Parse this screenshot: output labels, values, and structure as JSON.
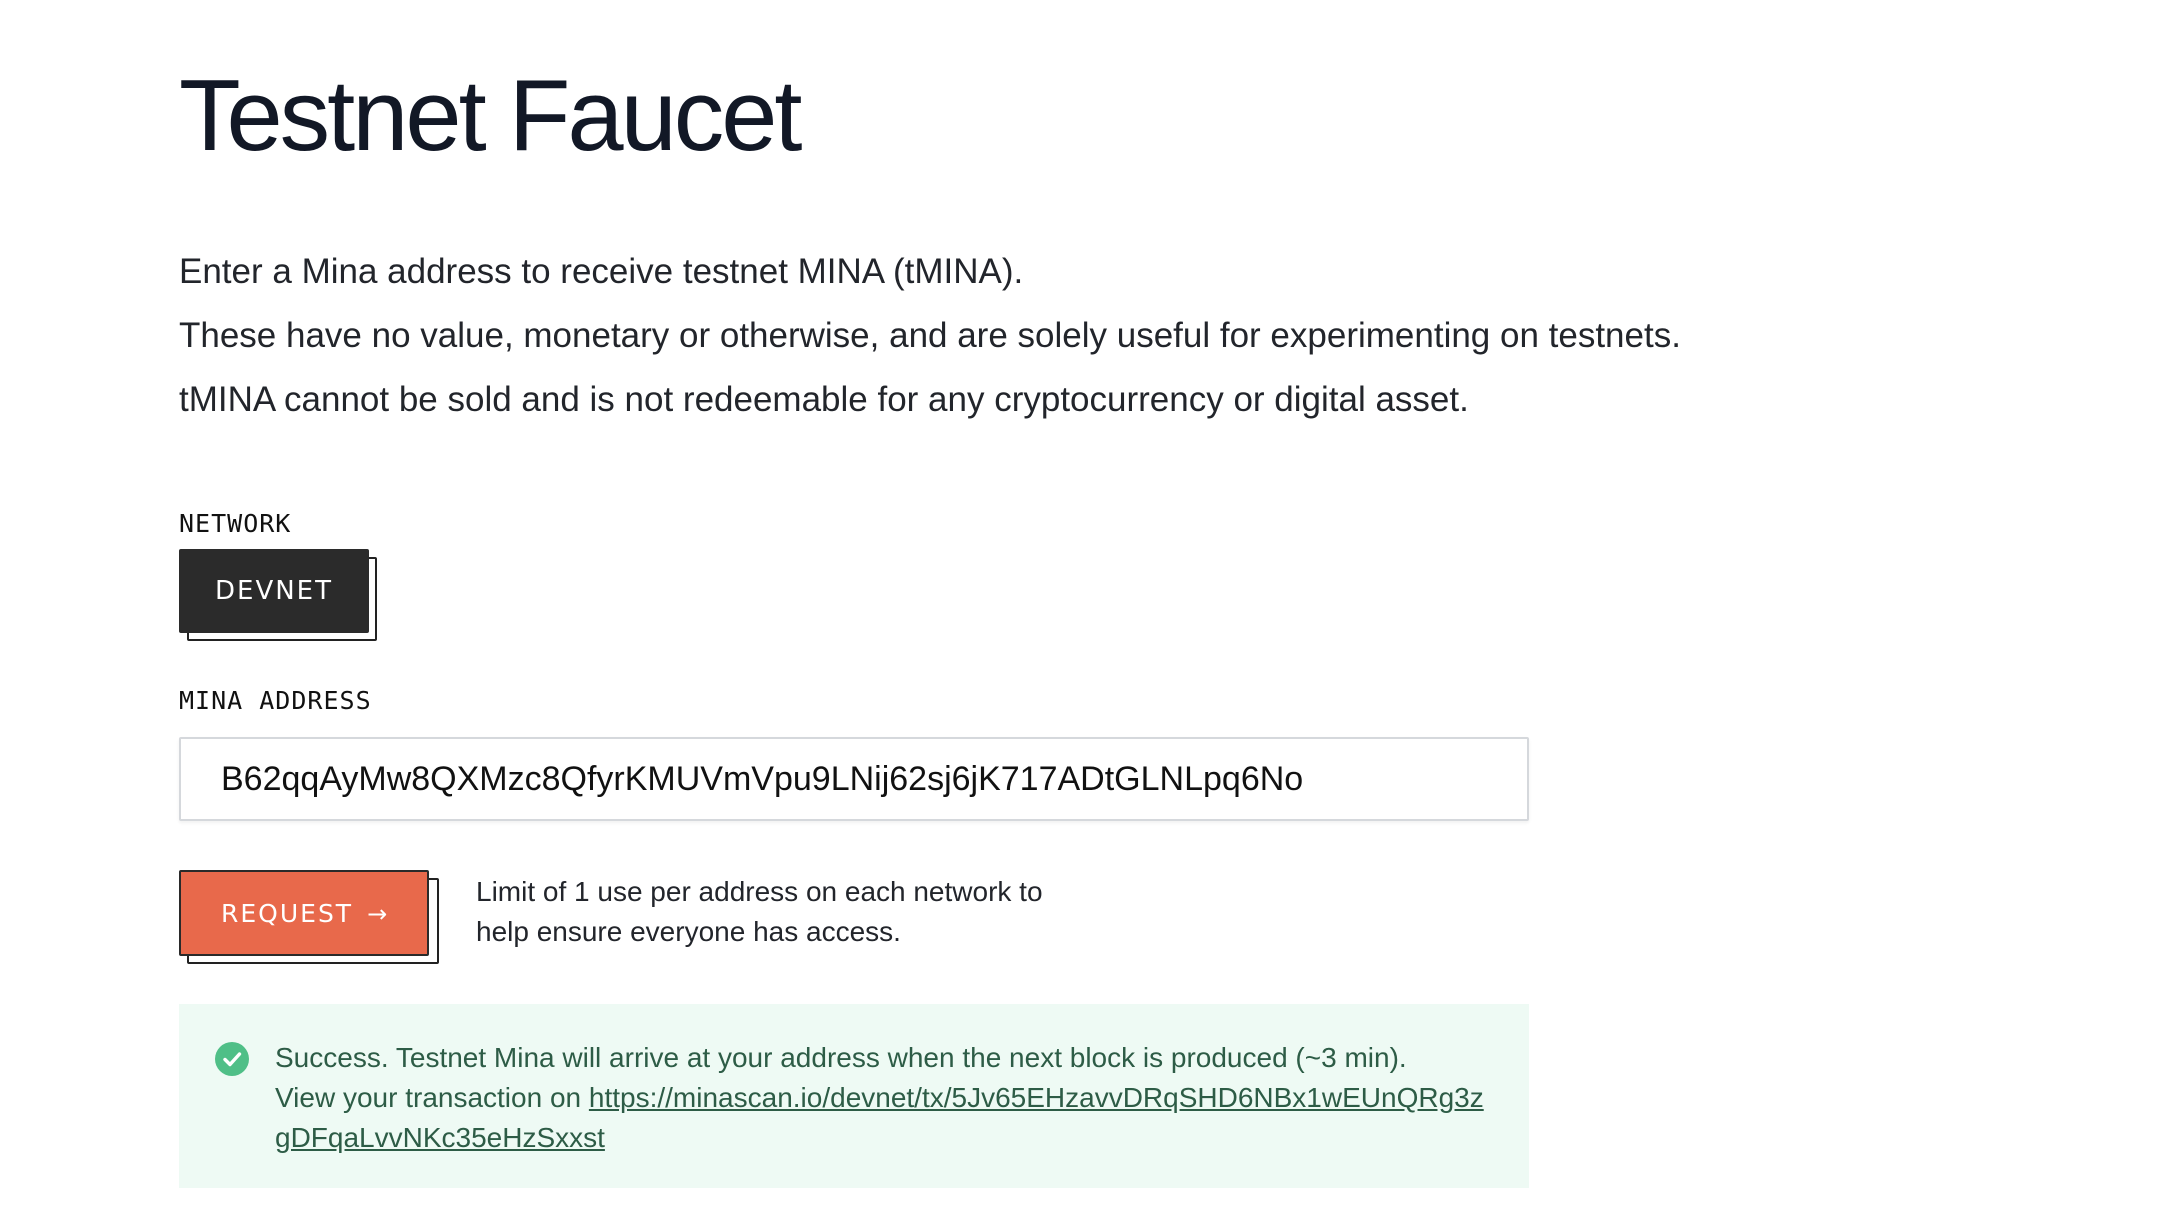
{
  "page": {
    "title": "Testnet Faucet"
  },
  "intro": {
    "line1": "Enter a Mina address to receive testnet MINA (tMINA).",
    "line2": "These have no value, monetary or otherwise, and are solely useful for experimenting on testnets.",
    "line3": "tMINA cannot be sold and is not redeemable for any cryptocurrency or digital asset."
  },
  "network": {
    "label": "NETWORK",
    "selected": "DEVNET"
  },
  "address": {
    "label": "MINA ADDRESS",
    "value": "B62qqAyMw8QXMzc8QfyrKMUVmVpu9LNij62sj6jK717ADtGLNLpq6No"
  },
  "request": {
    "button_label": "REQUEST",
    "arrow": "→",
    "limit_note": "Limit of 1 use per address on each network to help ensure everyone has access."
  },
  "success": {
    "message": "Success. Testnet Mina will arrive at your address when the next block is produced (~3 min).",
    "view_prefix": "View your transaction on ",
    "tx_link": "https://minascan.io/devnet/tx/5Jv65EHzavvDRqSHD6NBx1wEUnQRg3zgDFqaLvvNKc35eHzSxxst",
    "icon": "check-circle-icon",
    "color": "#4fbf87"
  }
}
